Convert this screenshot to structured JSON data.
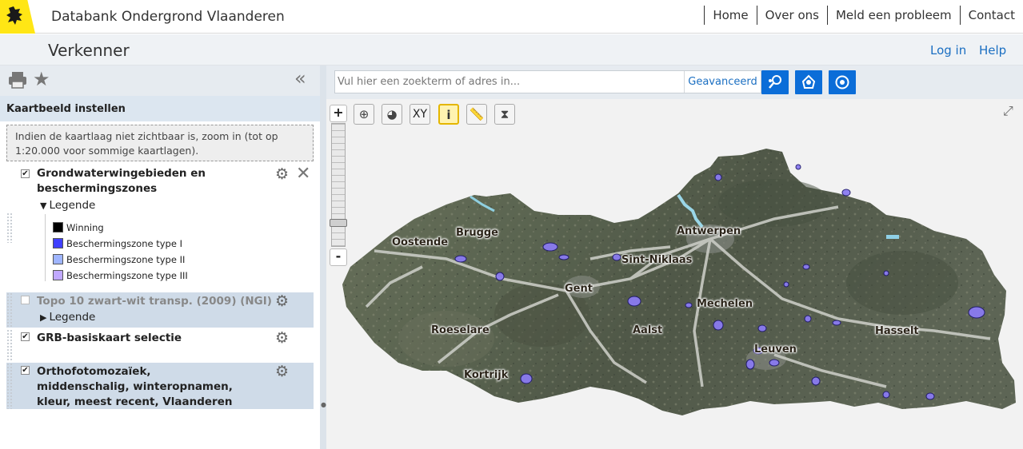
{
  "header": {
    "site_title": "Databank Ondergrond Vlaanderen",
    "nav": [
      "Home",
      "Over ons",
      "Meld een probleem",
      "Contact"
    ]
  },
  "subheader": {
    "title": "Verkenner",
    "login": "Log in",
    "help": "Help"
  },
  "sidebar": {
    "section_title": "Kaartbeeld instellen",
    "hint": "Indien de kaartlaag niet zichtbaar is, zoom in (tot op 1:20.000 voor sommige kaartlagen).",
    "layers": [
      {
        "name": "Grondwaterwingebieden en beschermingszones",
        "checked": true,
        "legend_toggle": "Legende",
        "legend_expanded": true,
        "legend": [
          {
            "label": "Winning",
            "color": "#000000"
          },
          {
            "label": "Beschermingszone type I",
            "color": "#4040ff"
          },
          {
            "label": "Beschermingszone type II",
            "color": "#9fb5ff"
          },
          {
            "label": "Beschermingszone type III",
            "color": "#c0a8ff"
          }
        ]
      },
      {
        "name": "Topo 10 zwart-wit transp. (2009) (NGI)",
        "checked": false,
        "legend_toggle": "Legende",
        "legend_expanded": false
      },
      {
        "name": "GRB-basiskaart selectie",
        "checked": true
      },
      {
        "name": "Orthofotomozaïek, middenschalig, winteropnamen, kleur, meest recent, Vlaanderen",
        "checked": true
      }
    ]
  },
  "search": {
    "placeholder": "Vul hier een zoekterm of adres in...",
    "advanced": "Geavanceerd"
  },
  "map": {
    "zoom_in": "+",
    "zoom_out": "-",
    "tool_xy": "XY",
    "cities": [
      "Oostende",
      "Brugge",
      "Antwerpen",
      "Sint-Niklaas",
      "Gent",
      "Mechelen",
      "Roeselare",
      "Aalst",
      "Leuven",
      "Hasselt",
      "Kortrijk"
    ]
  },
  "colors": {
    "accent": "#1b6fc2",
    "button_blue": "#0b6dd8",
    "logo_yellow": "#ffe615",
    "panel_header": "#dce6f0"
  }
}
